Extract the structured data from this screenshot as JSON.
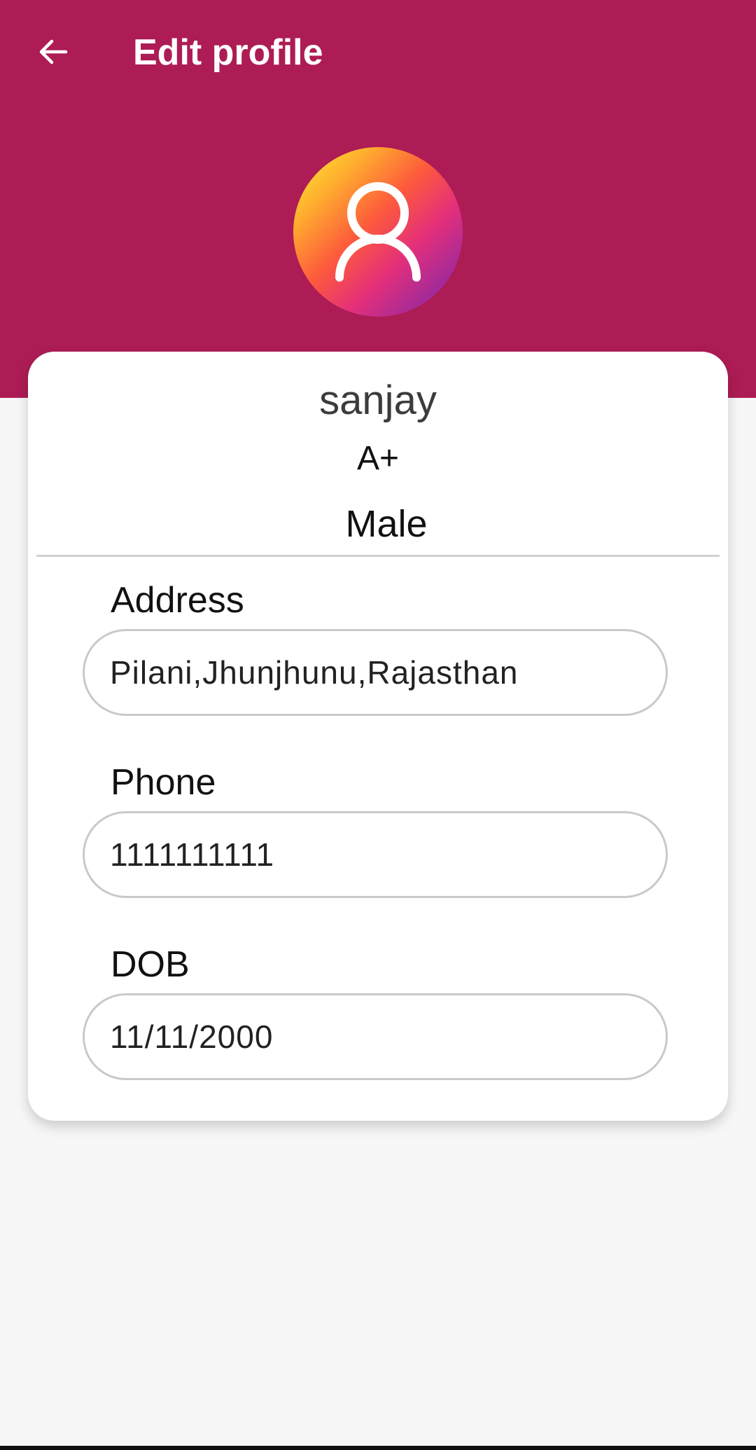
{
  "app_bar": {
    "title": "Edit profile",
    "back_icon": "arrow-left-icon"
  },
  "profile": {
    "avatar_icon": "user-icon",
    "name": "sanjay",
    "blood_group": "A+",
    "gender": "Male"
  },
  "fields": {
    "address": {
      "label": "Address",
      "value": "Pilani,Jhunjhunu,Rajasthan"
    },
    "phone": {
      "label": "Phone",
      "value": "1111111111"
    },
    "dob": {
      "label": "DOB",
      "value": "11/11/2000"
    }
  },
  "colors": {
    "header": "#ad1c55",
    "background": "#f7f7f7",
    "card": "#ffffff"
  }
}
